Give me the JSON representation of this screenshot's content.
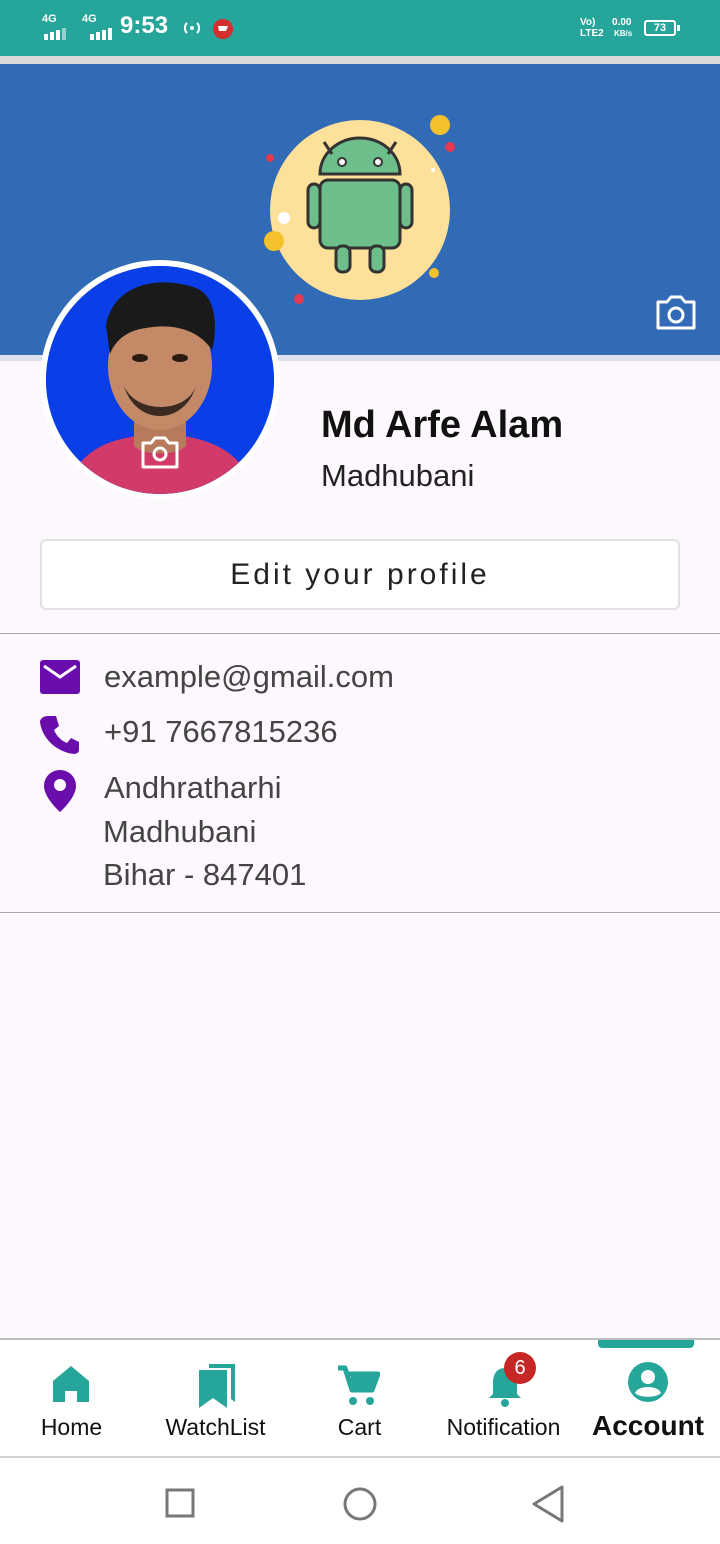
{
  "status_bar": {
    "network1": "4G",
    "network2": "4G",
    "time": "9:53",
    "volte": "Vo)",
    "lte": "LTE2",
    "speed_value": "0.00",
    "speed_unit": "KB/s",
    "battery": "73"
  },
  "profile": {
    "name": "Md Arfe Alam",
    "city": "Madhubani",
    "edit_label": "Edit your profile"
  },
  "contact": {
    "email": "example@gmail.com",
    "phone": "+91 7667815236",
    "address_line1": "Andhratharhi",
    "address_line2": "Madhubani",
    "address_line3": "Bihar - 847401"
  },
  "nav": {
    "items": [
      {
        "label": "Home",
        "icon": "home-icon"
      },
      {
        "label": "WatchList",
        "icon": "bookmarks-icon"
      },
      {
        "label": "Cart",
        "icon": "cart-icon"
      },
      {
        "label": "Notification",
        "icon": "bell-icon"
      },
      {
        "label": "Account",
        "icon": "account-circle-icon"
      }
    ],
    "active": "Account",
    "notification_badge": "6",
    "accent_color": "#26a69a"
  },
  "colors": {
    "cover": "#316ab5",
    "icons": "#6a0dad"
  }
}
